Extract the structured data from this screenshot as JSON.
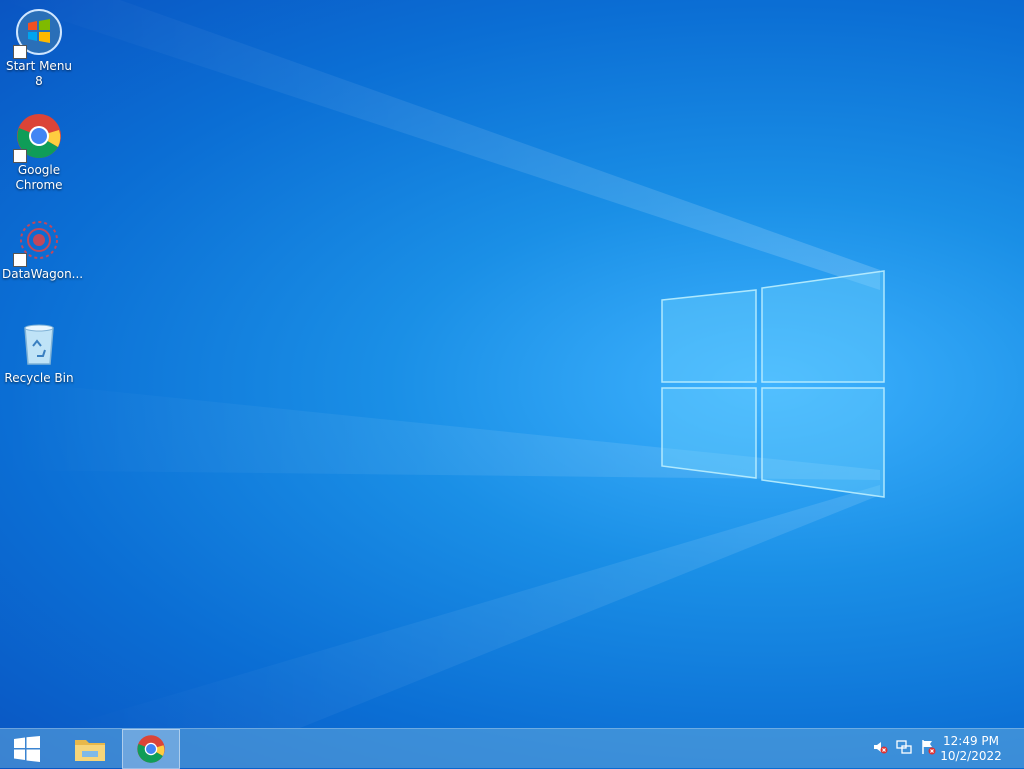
{
  "desktop": {
    "icons": [
      {
        "label": "Start Menu 8",
        "icon": "start-menu-8-icon"
      },
      {
        "label": "Google Chrome",
        "icon": "chrome-icon"
      },
      {
        "label": "DataWagon...",
        "icon": "datawagon-icon"
      },
      {
        "label": "Recycle Bin",
        "icon": "recycle-bin-icon"
      }
    ]
  },
  "taskbar": {
    "start_icon": "windows-logo-icon",
    "pinned": [
      {
        "icon": "file-explorer-icon",
        "active": false
      },
      {
        "icon": "chrome-icon",
        "active": true
      }
    ],
    "tray_icons": [
      "volume-muted-icon",
      "network-icon",
      "action-center-flag-icon"
    ],
    "clock": {
      "time": "12:49 PM",
      "date": "10/2/2022"
    }
  },
  "colors": {
    "wallpaper_center": "#3fb3ff",
    "wallpaper_edge": "#0a55c2",
    "taskbar": "#64aadc"
  }
}
